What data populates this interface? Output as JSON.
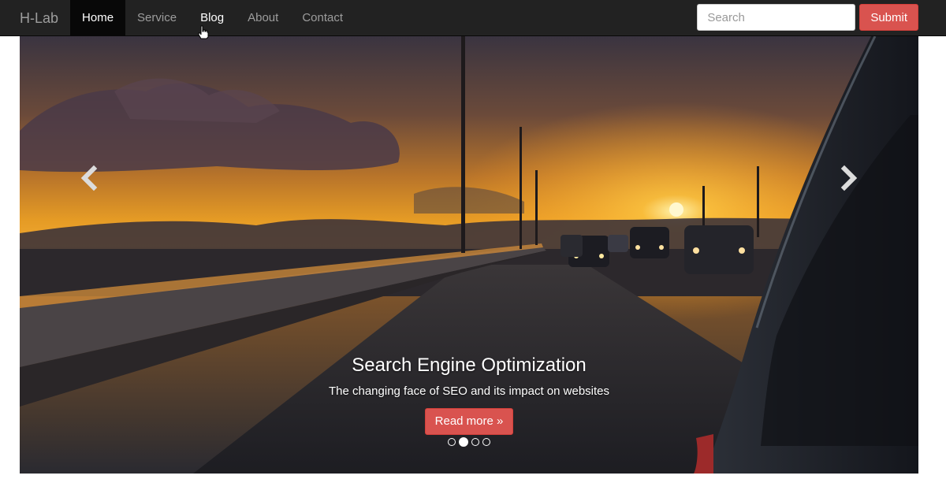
{
  "navbar": {
    "brand": "H-Lab",
    "items": [
      {
        "label": "Home",
        "active": true
      },
      {
        "label": "Service",
        "active": false
      },
      {
        "label": "Blog",
        "active": false
      },
      {
        "label": "About",
        "active": false
      },
      {
        "label": "Contact",
        "active": false
      }
    ],
    "search": {
      "placeholder": "Search",
      "value": ""
    },
    "submit_label": "Submit"
  },
  "carousel": {
    "caption": {
      "title": "Search Engine Optimization",
      "text": "The changing face of SEO and its impact on websites",
      "button_label": "Read more »"
    },
    "slide_count": 4,
    "active_slide": 2,
    "prev_icon": "chevron-left-icon",
    "next_icon": "chevron-right-icon"
  },
  "colors": {
    "navbar_bg": "#222222",
    "nav_text": "#9d9d9d",
    "accent_red": "#d9534f"
  }
}
